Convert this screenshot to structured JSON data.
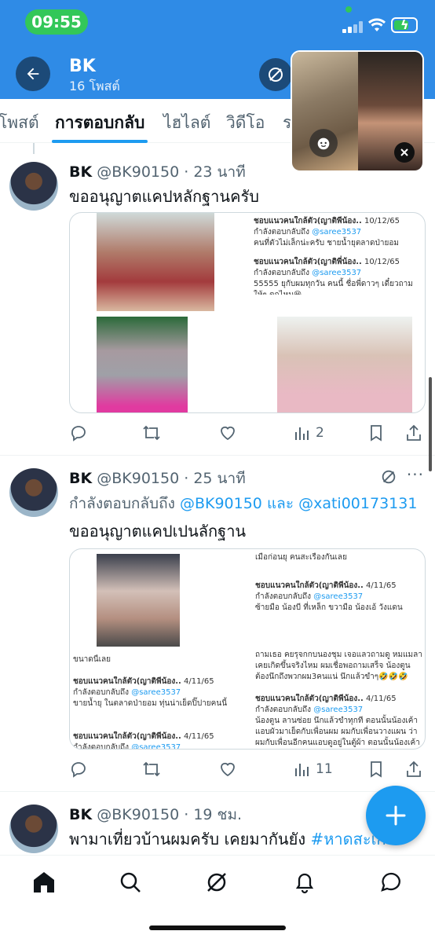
{
  "status_bar": {
    "time": "09:55"
  },
  "header": {
    "name": "BK",
    "post_count": "16 โพสต์"
  },
  "tabs": [
    "โพสต์",
    "การตอบกลับ",
    "ไฮไลต์",
    "วิดีโอ",
    "ร"
  ],
  "active_tab": "การตอบกลับ",
  "tweets": [
    {
      "name": "BK",
      "handle": "@BK90150",
      "sep": "·",
      "time": "23 นาที",
      "text": "ขออนุญาตแคปหลักฐานครับ",
      "media_captions": [
        {
          "user": "ชอบแนวคนใกล้ตัว(ญาติพี่น้อง..",
          "date": "10/12/65",
          "reply_to": "กำลังตอบกลับถึง",
          "reply_handle": "@saree3537",
          "body": "คนที่ตัวไม่เล็กน่ะครับ ชายน้ำยุตลาดป่ายอม"
        },
        {
          "user": "ชอบแนวคนใกล้ตัว(ญาติพี่น้อง..",
          "date": "10/12/65",
          "reply_to": "กำลังตอบกลับถึง",
          "reply_handle": "@saree3537",
          "body": "55555 ยุกับผมทุกวัน คนนี้ ชื่อพี่ดาวๆ เดี๋ยวถามให้ๆ ตกไหม😆"
        }
      ],
      "stats": {
        "views": "2"
      }
    },
    {
      "name": "BK",
      "handle": "@BK90150",
      "sep": "·",
      "time": "25 นาที",
      "reply_prefix": "กำลังตอบกลับถึง",
      "reply_user1": "@BK90150",
      "reply_and": "และ",
      "reply_user2": "@xati00173131",
      "text": "ขออนุญาตแคปเปนลักฐาน",
      "media_captions": [
        {
          "body": "เมื่อก่อนยุ คนสะเรื่องกันเลย"
        },
        {
          "user": "ชอบแนวคนใกล้ตัว(ญาติพี่น้อง..",
          "date": "4/11/65",
          "reply_to": "กำลังตอบกลับถึง",
          "reply_handle": "@saree3537",
          "body": "ซ้ายมือ น้องบี ที่เหล็ก ขวามือ น้องเอ้ วังแดน"
        },
        {
          "body": "ถามเธอ คยรุจกกบนองชุม เจอแลวถามดู หมแมลา เคยเกิดขึ้นจริงไหม ผมเชื่อพอถามเสร็จ น้องตูนต้องนึกถึงพวกผม3คนแน่ นึกแล้วขำๆ🤣🤣🤣"
        },
        {
          "user": "ชอบแนวคนใกล้ตัว(ญาติพี่น้อง..",
          "date": "4/11/65",
          "reply_to": "กำลังตอบกลับถึง",
          "reply_handle": "@saree3537",
          "body": "ขายน้ำยุ ในตลาดป่ายอม ทุ่นน่าเย็ดปิ๊ปายคนนี้"
        },
        {
          "user": "ชอบแนวคนใกล้ตัว(ญาติพี่น้อง..",
          "date": "4/11/65",
          "reply_to": "กำลังตอบกลับถึง",
          "reply_handle": "@saree3537",
          "body": "น้องตูน ลานซ่อย นึกแล้วขำทุกที ตอนนั้นน้องเค้าแอบผัวมาเย็ดกับเพื่อนผม ผมกับเพื่อนวางแผน ว่าผมกับเพื่อนอีกคนแอบดูอยู่ในตู้ผ้า ตอนนั้นน้องเค้าเรียนยูพานิช ตอ ใครชอบ"
        },
        {
          "body": "ขนาดนี้เลย"
        },
        {
          "user": "ชอบแนวคนใกล้ตัว(ญาติพี่น้อง..",
          "date": "4/11/65",
          "reply_to": "กำลังตอบกลับถึง",
          "reply_handle": "@saree3537",
          "body": ""
        }
      ],
      "stats": {
        "views": "11"
      }
    },
    {
      "name": "BK",
      "handle": "@BK90150",
      "sep": "·",
      "time": "19 ชม.",
      "text": "พามาเที่ยวบ้านผมครับ เคยมากันยัง",
      "hashtag": "#หาดสะเก"
    }
  ],
  "colors": {
    "accent": "#1d9bf0",
    "header_bg": "#2f8be6",
    "status_green": "#33c759"
  },
  "icons": [
    "back-arrow-icon",
    "grok-icon",
    "camera-effects-icon",
    "reply-icon",
    "retweet-icon",
    "like-icon",
    "views-icon",
    "bookmark-icon",
    "share-icon",
    "home-icon",
    "search-icon",
    "grok-nav-icon",
    "bell-icon",
    "messages-icon",
    "plus-icon"
  ]
}
